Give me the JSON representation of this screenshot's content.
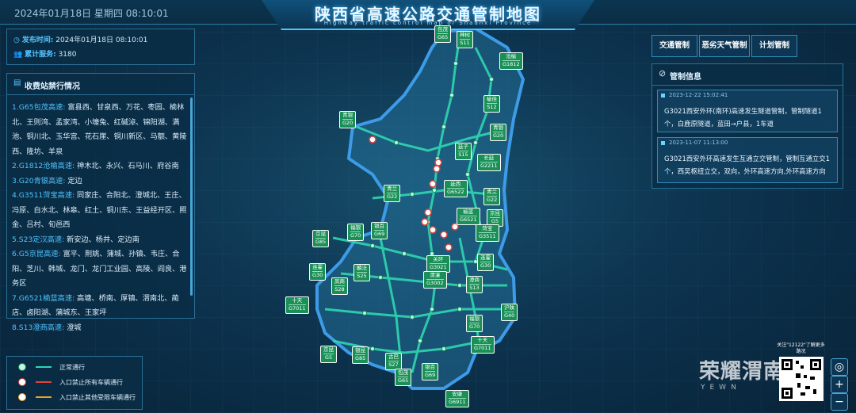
{
  "header": {
    "datetime": "2024年01月18日 星期四  08:10:01",
    "title": "陕西省高速公路交通管制地图",
    "subtitle": "Highway traffic control map of Shaanxi Province"
  },
  "info": {
    "publish_label": "发布时间:",
    "publish_value": "2024年01月18日  08:10:01",
    "service_label": "累计服务:",
    "service_value": "3180"
  },
  "toll_panel": {
    "title": "收费站禁行情况",
    "items": [
      {
        "road": "1.G65包茂高速:",
        "stations": "富县西、甘泉西、万花、枣园、榆林北、王则湾、孟家湾、小壕兔、红碱淖、锦阳湖、满池、铜川北、玉华宫、花石崖、铜川新区、马额、黄陵西、隆坊、羊泉"
      },
      {
        "road": "2.G1812沧榆高速:",
        "stations": "神木北、永兴、石马川、府谷南"
      },
      {
        "road": "3.G20青银高速:",
        "stations": "定边"
      },
      {
        "road": "4.G3511菏宝高速:",
        "stations": "同家庄、合阳北、澄城北、王庄、冯原、白水北、林皋、红土、铜川东、王益经开区、照金、吕村、旬邑西"
      },
      {
        "road": "5.S23定汉高速:",
        "stations": "新安边、杨井、定边南"
      },
      {
        "road": "6.G5京昆高速:",
        "stations": "富平、荆姚、蒲城、孙镇、韦庄、合阳、芝川、韩城、龙门、龙门工业园、高陵、阎良、港务区"
      },
      {
        "road": "7.G6521榆蓝高速:",
        "stations": "高塘、桥南、厚镇、渭南北、蔺店、卤阳湖、蒲城东、王家坪"
      },
      {
        "road": "8.S13澄商高速:",
        "stations": "澄城"
      }
    ]
  },
  "legend": [
    {
      "label": "正常通行",
      "color": "#2fd6b0"
    },
    {
      "label": "入口禁止所有车辆通行",
      "color": "#e0433a"
    },
    {
      "label": "入口禁止其他受限车辆通行",
      "color": "#f0a030"
    }
  ],
  "tabs": [
    "交通管制",
    "恶劣天气管制",
    "计划管制"
  ],
  "control": {
    "title": "管制信息",
    "notices": [
      {
        "time": "2023-12-22 15:02:41",
        "text": "G3021西安外环(南环)高速发生隧道管制，管制隧道1个，白鹿原隧道，蓝田→户县，1车道"
      },
      {
        "time": "2023-11-07 11:13:00",
        "text": "G3021西安外环高速发生互通立交管制，管制互通立交1个，西吴枢纽立交，双向，外环高速方向,外环高速方向"
      }
    ]
  },
  "map_labels": [
    {
      "name": "神树",
      "code": "S11"
    },
    {
      "name": "包茂",
      "code": "G65"
    },
    {
      "name": "沧榆",
      "code": "G1812"
    },
    {
      "name": "榆佳",
      "code": "S12"
    },
    {
      "name": "青银",
      "code": "G20"
    },
    {
      "name": "青银",
      "code": "G20"
    },
    {
      "name": "延子",
      "code": "S15"
    },
    {
      "name": "长延",
      "code": "G2211"
    },
    {
      "name": "延西",
      "code": "G6522"
    },
    {
      "name": "青兰",
      "code": "G22"
    },
    {
      "name": "青兰",
      "code": "G22"
    },
    {
      "name": "榆蓝",
      "code": "G6521"
    },
    {
      "name": "京昆",
      "code": "G5"
    },
    {
      "name": "菏宝",
      "code": "G3511"
    },
    {
      "name": "福银",
      "code": "G70"
    },
    {
      "name": "银百",
      "code": "G69"
    },
    {
      "name": "京昆",
      "code": "G85"
    },
    {
      "name": "连霍",
      "code": "G30"
    },
    {
      "name": "关环",
      "code": "G3021"
    },
    {
      "name": "麟法",
      "code": "S25"
    },
    {
      "name": "连霍",
      "code": "G30"
    },
    {
      "name": "渭潼",
      "code": "G3002"
    },
    {
      "name": "澄商",
      "code": "S13"
    },
    {
      "name": "凤商",
      "code": "S28"
    },
    {
      "name": "十天",
      "code": "G7011"
    },
    {
      "name": "福银",
      "code": "G70"
    },
    {
      "name": "沪陕",
      "code": "G40"
    },
    {
      "name": "十天",
      "code": "G7011"
    },
    {
      "name": "京昆",
      "code": "G5"
    },
    {
      "name": "银昆",
      "code": "G85"
    },
    {
      "name": "古巴",
      "code": "S27"
    },
    {
      "name": "包茂",
      "code": "G65"
    },
    {
      "name": "银百",
      "code": "G69"
    },
    {
      "name": "安康",
      "code": "G6911"
    }
  ],
  "qr": {
    "text": "关注\"12122\"了解更多路况"
  },
  "watermark": {
    "text": "荣耀渭南",
    "sub": "YEWN"
  },
  "zoom": {
    "locate": "◎",
    "plus": "+",
    "minus": "−"
  }
}
